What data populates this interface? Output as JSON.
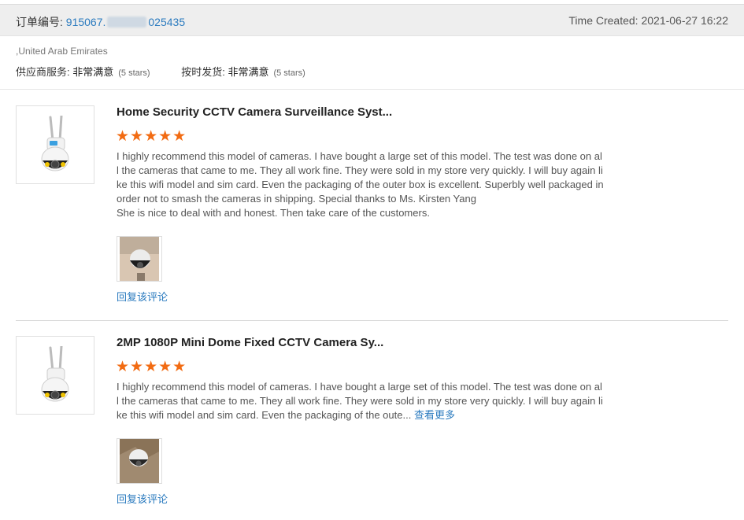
{
  "order": {
    "label": "订单编号: ",
    "number_start": "915067.",
    "number_end": "025435",
    "time_created": "Time Created: 2021-06-27 16:22"
  },
  "buyer": {
    "country": ",United Arab Emirates"
  },
  "ratings": [
    {
      "label": "供应商服务: ",
      "value": "非常满意",
      "stars_text": "(5 stars)"
    },
    {
      "label": "按时发货: ",
      "value": "非常满意",
      "stars_text": "(5 stars)"
    }
  ],
  "reviews": [
    {
      "title": "Home Security CCTV Camera Surveillance Syst...",
      "stars": "★★★★★",
      "rating": 5,
      "lines": [
        "I highly recommend this model of cameras. I have bought a large set of this model. The test was done on al",
        "l the cameras that came to me. They all work fine. They were sold in my store very quickly. I will buy again li",
        "ke this wifi model and sim card. Even the packaging of the outer box is excellent. Superbly well packaged in",
        "order not to smash the cameras in shipping. Special thanks to Ms. Kirsten Yang",
        "She is nice to deal with and honest. Then take care of the customers."
      ],
      "reply": "回复该评论"
    },
    {
      "title": "2MP 1080P Mini Dome Fixed CCTV Camera Sy...",
      "stars": "★★★★★",
      "rating": 5,
      "lines": [
        "I highly recommend this model of cameras. I have bought a large set of this model. The test was done on al",
        "l the cameras that came to me. They all work fine. They were sold in my store very quickly. I will buy again li",
        "ke this wifi model and sim card. Even the packaging of the oute... "
      ],
      "more": "查看更多",
      "reply": "回复该评论"
    }
  ],
  "colors": {
    "link": "#2b7bbf",
    "star": "#f26b12",
    "header_bg": "#eeeeee"
  }
}
